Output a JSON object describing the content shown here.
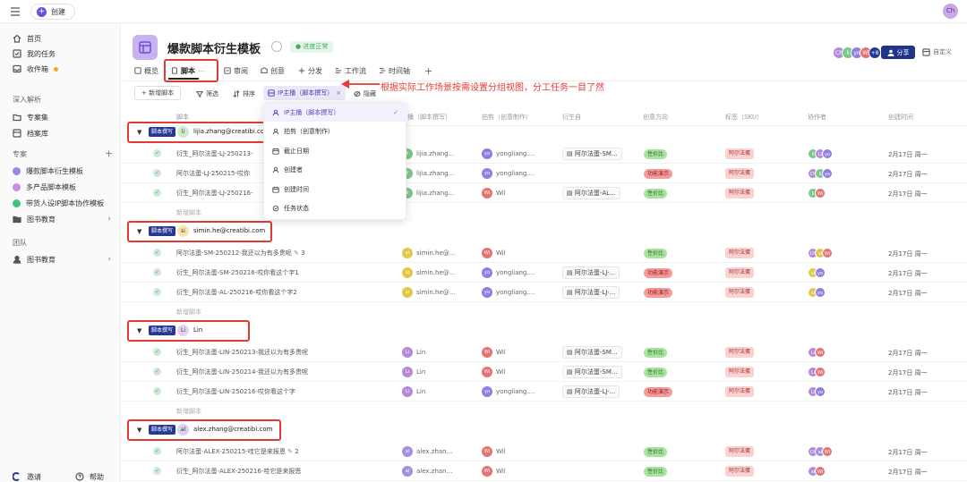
{
  "topbar": {
    "create_label": "创建",
    "user_initials": "Ch"
  },
  "sidebar": {
    "items_top": [
      {
        "label": "首页",
        "icon": "home-icon"
      },
      {
        "label": "我的任务",
        "icon": "task-icon"
      },
      {
        "label": "收件箱",
        "icon": "inbox-icon"
      }
    ],
    "deep_analysis": "深入解析",
    "deep_items": [
      {
        "label": "专案集",
        "icon": "folder-icon"
      },
      {
        "label": "档案库",
        "icon": "archive-icon"
      }
    ],
    "projects_head": "专案",
    "projects": [
      {
        "label": "爆款脚本衍生模板",
        "color": "#9e86e8"
      },
      {
        "label": "多产品脚本模板",
        "color": "#c58ee4"
      },
      {
        "label": "带货人设IP脚本协作模板",
        "color": "#3fc27a"
      },
      {
        "label": "图书教育",
        "color": "#555555"
      }
    ],
    "team_head": "团队",
    "team_items": [
      {
        "label": "图书教育"
      }
    ],
    "invite_label": "邀请",
    "help_label": "帮助"
  },
  "header": {
    "title": "爆款脚本衍生模板",
    "status": "● 进度正常",
    "share_label": "分享",
    "custom_label": "自定义",
    "collab_avatars": [
      {
        "t": "Ch",
        "c": "#b48ad8"
      },
      {
        "t": "li",
        "c": "#7dc78a"
      },
      {
        "t": "yo",
        "c": "#8f7fe0"
      },
      {
        "t": "Wi",
        "c": "#e57373"
      },
      {
        "t": "+8",
        "c": "#253894"
      }
    ]
  },
  "tabs": [
    {
      "label": "概览",
      "icon": "overview-icon"
    },
    {
      "label": "脚本",
      "icon": "script-icon"
    },
    {
      "label": "审阅",
      "icon": "review-icon"
    },
    {
      "label": "创意",
      "icon": "idea-icon"
    },
    {
      "label": "分发",
      "icon": "distribute-icon"
    },
    {
      "label": "工作流",
      "icon": "workflow-icon"
    },
    {
      "label": "时间轴",
      "icon": "timeline-icon"
    }
  ],
  "toolbar": {
    "add_label": "+ 新增脚本",
    "filter_label": "筛选",
    "sort_label": "排序",
    "group_label": "IP主播（脚本撰写）",
    "hide_label": "隐藏"
  },
  "annotation": "根据实际工作场景按需设置分组视图，分工任务一目了然",
  "table": {
    "columns": [
      "脚本",
      "主播（脚本撰写）",
      "拍剪（创意制作）",
      "衍生自",
      "创意方向",
      "标签（SKU）",
      "协作者",
      "创建时间"
    ]
  },
  "dropdown": {
    "items": [
      {
        "label": "IP主播（脚本撰写）",
        "icon": "person-icon"
      },
      {
        "label": "拍剪（创意制作）",
        "icon": "person-icon"
      },
      {
        "label": "截止日期",
        "icon": "calendar-icon"
      },
      {
        "label": "创建者",
        "icon": "person-icon"
      },
      {
        "label": "创建时间",
        "icon": "calendar-icon"
      },
      {
        "label": "任务状态",
        "icon": "status-icon"
      }
    ]
  },
  "groups": [
    {
      "tag": "脚本撰写",
      "initials": "li",
      "name": "lijia.zhang@creatibi.com",
      "av_color": "#cdeacc",
      "rows": [
        {
          "name": "衍生_阿尔法蛋-LJ-250213-",
          "host": "lijia.zhang...",
          "host_av": "li",
          "host_c": "#7dc78a",
          "editor": "yongliang....",
          "ed_av": "yo",
          "ed_c": "#8f7fe0",
          "derived": "阿尔法蛋-SM...",
          "dir": "性价比",
          "dir_type": "green",
          "sku": "阿尔法蛋",
          "collab": [
            "li",
            "Li",
            "yo"
          ],
          "date": "2月17日 周一"
        },
        {
          "name": "阿尔法蛋-LJ-250215-哎你",
          "host": "lijia.zhang...",
          "host_av": "li",
          "host_c": "#7dc78a",
          "editor": "yongliang....",
          "ed_av": "yo",
          "ed_c": "#8f7fe0",
          "derived": "",
          "dir": "功能演示",
          "dir_type": "red",
          "sku": "阿尔法蛋",
          "collab": [
            "Ch",
            "li",
            "yo"
          ],
          "date": "2月17日 周一"
        },
        {
          "name": "衍生_阿尔法蛋-LJ-250216-",
          "host": "lijia.zhang...",
          "host_av": "li",
          "host_c": "#7dc78a",
          "editor": "Wil",
          "ed_av": "Wi",
          "ed_c": "#e57373",
          "derived": "阿尔法蛋-AL...",
          "dir": "性价比",
          "dir_type": "green",
          "sku": "阿尔法蛋",
          "collab": [
            "li",
            "Wi"
          ],
          "date": "2月17日 周一"
        }
      ]
    },
    {
      "tag": "脚本撰写",
      "initials": "si",
      "name": "simin.he@creatibi.com",
      "av_color": "#f5e6a8",
      "rows": [
        {
          "name": "阿尔法蛋-SM-250212-我还以为有多贵呢",
          "comment": "3",
          "host": "simin.he@...",
          "host_av": "si",
          "host_c": "#e2c84a",
          "editor": "Wil",
          "ed_av": "Wi",
          "ed_c": "#e57373",
          "derived": "",
          "dir": "性价比",
          "dir_type": "green",
          "sku": "阿尔法蛋",
          "collab": [
            "Ch",
            "si",
            "Wi"
          ],
          "date": "2月17日 周一"
        },
        {
          "name": "衍生_阿尔法蛋-SM-250216-哎你看这个字1",
          "host": "simin.he@...",
          "host_av": "si",
          "host_c": "#e2c84a",
          "editor": "yongliang....",
          "ed_av": "yo",
          "ed_c": "#8f7fe0",
          "derived": "阿尔法蛋-LJ-...",
          "dir": "功能演示",
          "dir_type": "red",
          "sku": "阿尔法蛋",
          "collab": [
            "si",
            "yo"
          ],
          "date": "2月17日 周一"
        },
        {
          "name": "衍生_阿尔法蛋-AL-250216-哎你看这个字2",
          "host": "simin.he@...",
          "host_av": "si",
          "host_c": "#e2c84a",
          "editor": "yongliang....",
          "ed_av": "yo",
          "ed_c": "#8f7fe0",
          "derived": "阿尔法蛋-LJ-...",
          "dir": "功能演示",
          "dir_type": "red",
          "sku": "阿尔法蛋",
          "collab": [
            "si",
            "yo"
          ],
          "date": "2月17日 周一"
        }
      ]
    },
    {
      "tag": "脚本撰写",
      "initials": "Li",
      "name": "Lin",
      "av_color": "#e4d2f5",
      "rows": [
        {
          "name": "衍生_阿尔法蛋-LIN-250213-我还以为有多贵呢",
          "host": "Lin",
          "host_av": "Li",
          "host_c": "#b48ad8",
          "editor": "Wil",
          "ed_av": "Wi",
          "ed_c": "#e57373",
          "derived": "阿尔法蛋-SM...",
          "dir": "性价比",
          "dir_type": "green",
          "sku": "阿尔法蛋",
          "collab": [
            "Li",
            "Wi"
          ],
          "date": "2月17日 周一"
        },
        {
          "name": "衍生_阿尔法蛋-LIN-250214-我还以为有多贵呢",
          "host": "Lin",
          "host_av": "Li",
          "host_c": "#b48ad8",
          "editor": "Wil",
          "ed_av": "Wi",
          "ed_c": "#e57373",
          "derived": "阿尔法蛋-SM...",
          "dir": "性价比",
          "dir_type": "green",
          "sku": "阿尔法蛋",
          "collab": [
            "Li",
            "Wi"
          ],
          "date": "2月17日 周一"
        },
        {
          "name": "衍生_阿尔法蛋-LIN-250216-哎你看这个字",
          "host": "Lin",
          "host_av": "Li",
          "host_c": "#b48ad8",
          "editor": "yongliang....",
          "ed_av": "yo",
          "ed_c": "#8f7fe0",
          "derived": "阿尔法蛋-LJ-...",
          "dir": "功能演示",
          "dir_type": "red",
          "sku": "阿尔法蛋",
          "collab": [
            "Li",
            "yo"
          ],
          "date": "2月17日 周一"
        }
      ]
    },
    {
      "tag": "脚本撰写",
      "initials": "al",
      "name": "alex.zhang@creatibi.com",
      "av_color": "#d9cff5",
      "rows": [
        {
          "name": "阿尔法蛋-ALEX-250215-哇它是来报恩",
          "comment": "2",
          "host": "alex.zhan...",
          "host_av": "al",
          "host_c": "#a58fe0",
          "editor": "Wil",
          "ed_av": "Wi",
          "ed_c": "#e57373",
          "derived": "",
          "dir": "性价比",
          "dir_type": "green",
          "sku": "阿尔法蛋",
          "collab": [
            "Ch",
            "al",
            "Wi"
          ],
          "date": "2月17日 周一"
        },
        {
          "name": "衍生_阿尔法蛋-ALEX-250216-哇它是来报恩",
          "host": "alex.zhan...",
          "host_av": "al",
          "host_c": "#a58fe0",
          "editor": "Wil",
          "ed_av": "Wi",
          "ed_c": "#e57373",
          "derived": "",
          "dir": "性价比",
          "dir_type": "green",
          "sku": "阿尔法蛋",
          "collab": [
            "al",
            "Wi"
          ],
          "date": "2月17日 周一"
        }
      ]
    }
  ],
  "add_row_label": "新增脚本"
}
